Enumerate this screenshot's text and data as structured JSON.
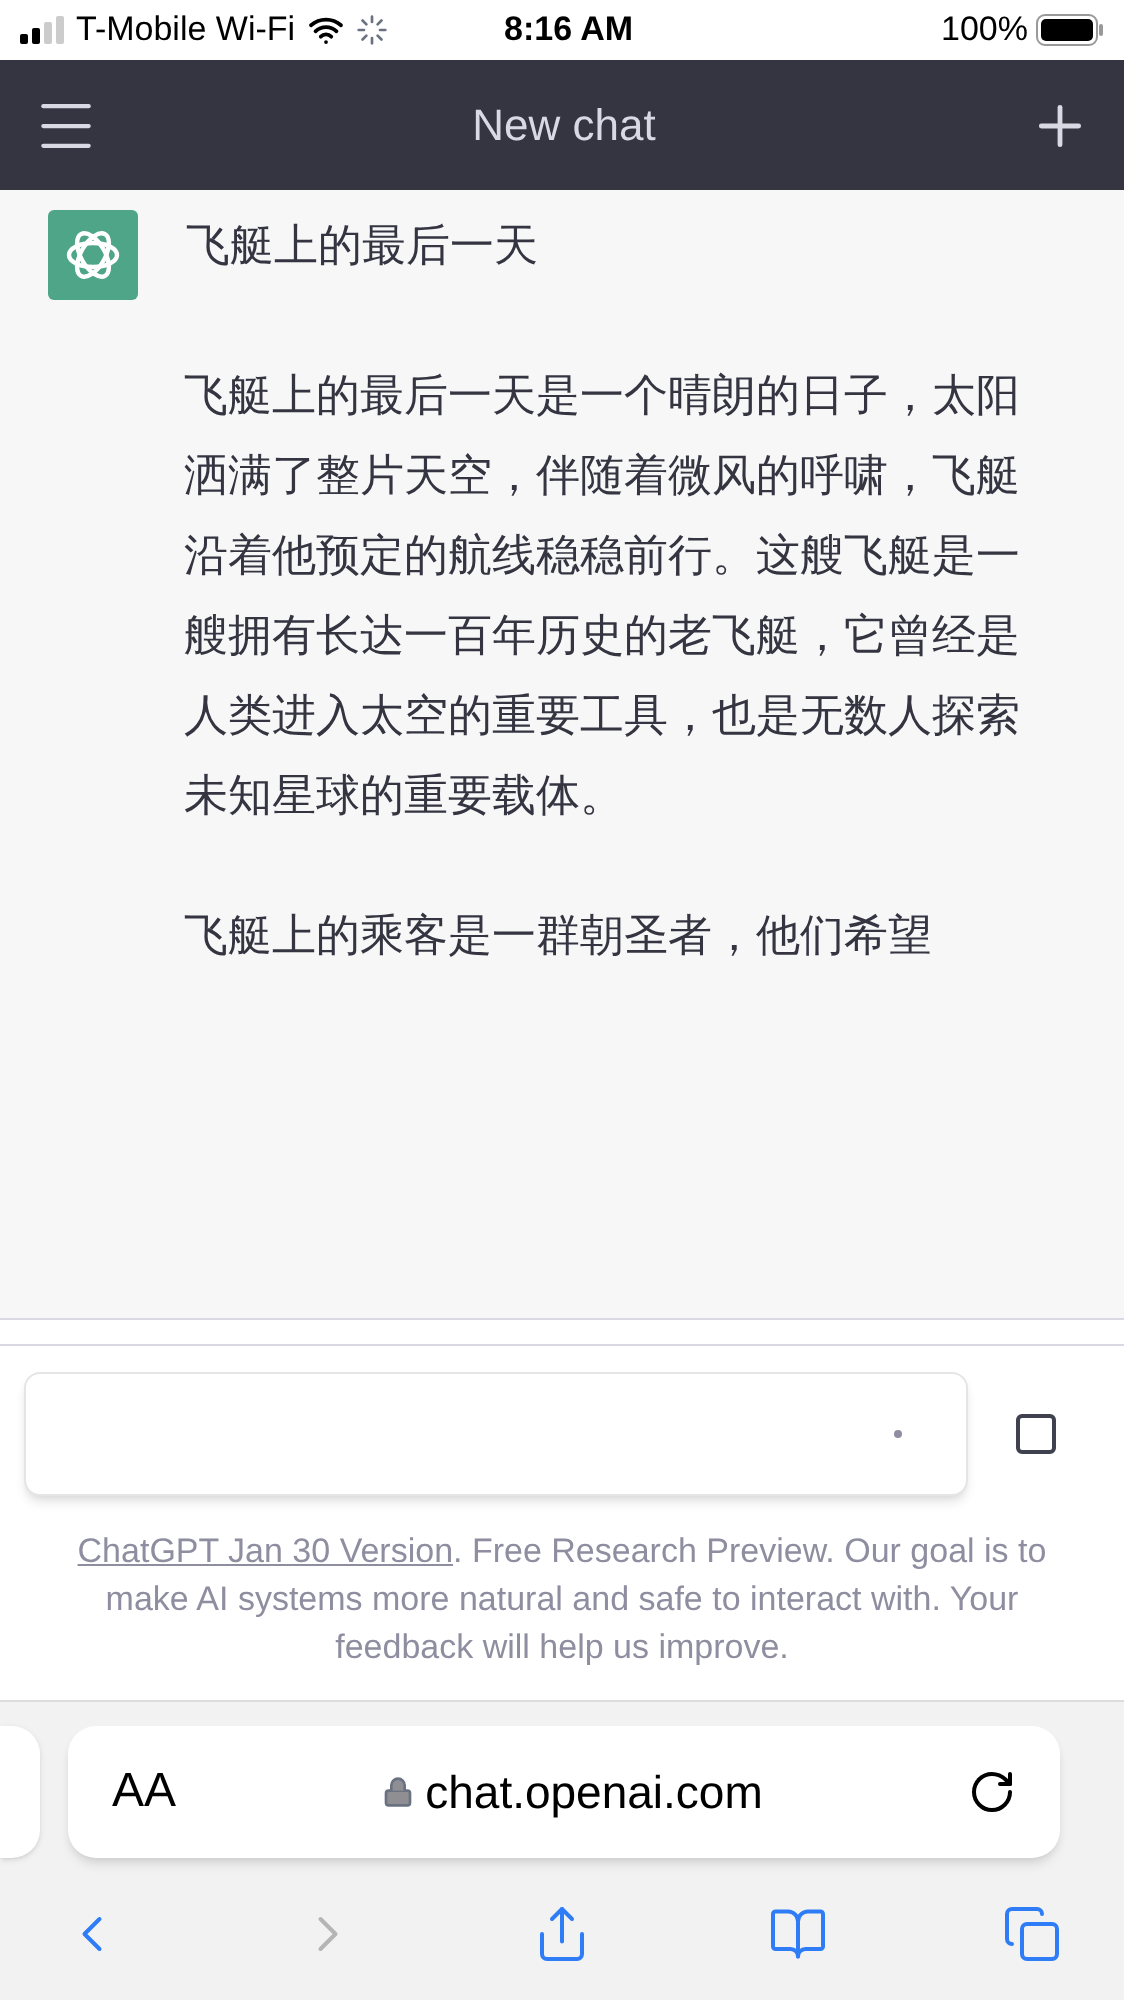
{
  "status_bar": {
    "carrier": "T-Mobile Wi-Fi",
    "time": "8:16 AM",
    "battery": "100%"
  },
  "header": {
    "title": "New chat"
  },
  "conversation": {
    "prompt": "飞艇上的最后一天",
    "paragraphs": [
      "飞艇上的最后一天是一个晴朗的日子，太阳洒满了整片天空，伴随着微风的呼啸，飞艇沿着他预定的航线稳稳前行。这艘飞艇是一艘拥有长达一百年历史的老飞艇，它曾经是人类进入太空的重要工具，也是无数人探索未知星球的重要载体。",
      "飞艇上的乘客是一群朝圣者，他们希望"
    ]
  },
  "footer": {
    "link": "ChatGPT Jan 30 Version",
    "text": ". Free Research Preview. Our goal is to make AI systems more natural and safe to interact with. Your feedback will help us improve."
  },
  "browser": {
    "text_size": "AA",
    "url": "chat.openai.com",
    "toolbar": [
      {
        "kind": "back",
        "disabled": false
      },
      {
        "kind": "forward",
        "disabled": true
      },
      {
        "kind": "share",
        "disabled": false
      },
      {
        "kind": "bookmarks",
        "disabled": false
      },
      {
        "kind": "tabs",
        "disabled": false
      }
    ]
  }
}
